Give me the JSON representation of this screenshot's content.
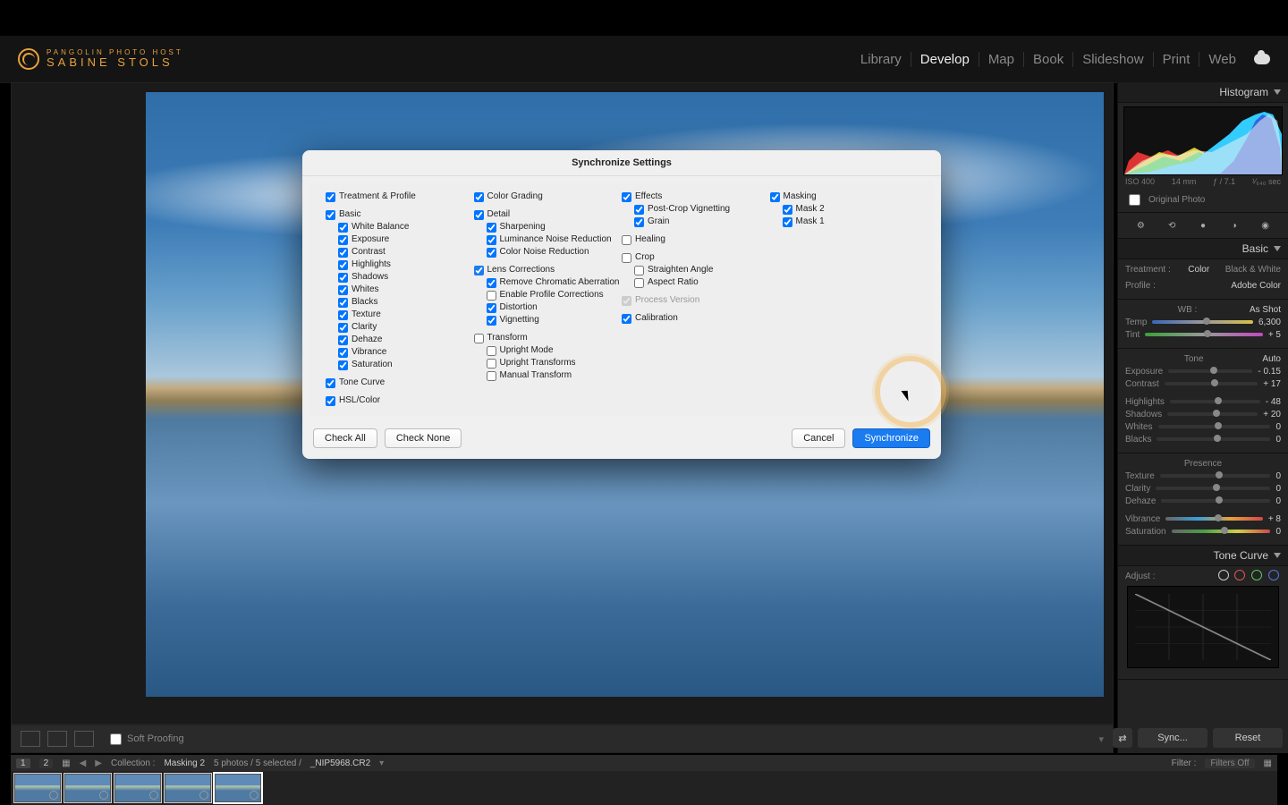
{
  "logo": {
    "line1": "PANGOLIN PHOTO HOST",
    "line2": "SABINE STOLS"
  },
  "modules": [
    "Library",
    "Develop",
    "Map",
    "Book",
    "Slideshow",
    "Print",
    "Web"
  ],
  "active_module": "Develop",
  "stage": {
    "soft_proof": "Soft Proofing"
  },
  "filmstrip": {
    "layout": "1",
    "layout2": "2",
    "collection_label": "Collection :",
    "collection_name": "Masking 2",
    "selection": "5 photos / 5 selected /",
    "filename": "_NIP5968.CR2",
    "filter_label": "Filter :",
    "filter_value": "Filters Off"
  },
  "side": {
    "histogram_title": "Histogram",
    "hist_meta": {
      "iso": "ISO 400",
      "fl": "14 mm",
      "ap": "ƒ / 7.1",
      "ss": "¹⁄₆₄₀ sec"
    },
    "original": "Original Photo",
    "basic_title": "Basic",
    "treatment_label": "Treatment :",
    "treatment_color": "Color",
    "treatment_bw": "Black & White",
    "profile_label": "Profile :",
    "profile_value": "Adobe Color",
    "wb_label": "WB :",
    "wb_value": "As Shot",
    "temp_label": "Temp",
    "temp_value": "6,300",
    "tint_label": "Tint",
    "tint_value": "+ 5",
    "tone_label": "Tone",
    "auto": "Auto",
    "exposure_label": "Exposure",
    "exposure_value": "- 0.15",
    "contrast_label": "Contrast",
    "contrast_value": "+ 17",
    "highlights_label": "Highlights",
    "highlights_value": "- 48",
    "shadows_label": "Shadows",
    "shadows_value": "+ 20",
    "whites_label": "Whites",
    "whites_value": "0",
    "blacks_label": "Blacks",
    "blacks_value": "0",
    "presence_label": "Presence",
    "texture_label": "Texture",
    "texture_value": "0",
    "clarity_label": "Clarity",
    "clarity_value": "0",
    "dehaze_label": "Dehaze",
    "dehaze_value": "0",
    "vibrance_label": "Vibrance",
    "vibrance_value": "+ 8",
    "saturation_label": "Saturation",
    "saturation_value": "0",
    "tonecurve_title": "Tone Curve",
    "adjust_label": "Adjust :",
    "sync_btn": "Sync...",
    "reset_btn": "Reset"
  },
  "dialog": {
    "title": "Synchronize Settings",
    "col1": {
      "treatment": "Treatment & Profile",
      "basic": "Basic",
      "basic_items": [
        "White Balance",
        "Exposure",
        "Contrast",
        "Highlights",
        "Shadows",
        "Whites",
        "Blacks",
        "Texture",
        "Clarity",
        "Dehaze",
        "Vibrance",
        "Saturation"
      ],
      "tone": "Tone Curve",
      "hsl": "HSL/Color"
    },
    "col2": {
      "color": "Color Grading",
      "detail": "Detail",
      "detail_items": [
        "Sharpening",
        "Luminance Noise Reduction",
        "Color Noise Reduction"
      ],
      "lens": "Lens Corrections",
      "lens_items": {
        "rca": "Remove Chromatic Aberration",
        "epc": "Enable Profile Corrections",
        "dist": "Distortion",
        "vig": "Vignetting"
      },
      "transform": "Transform",
      "transform_items": [
        "Upright Mode",
        "Upright Transforms",
        "Manual Transform"
      ]
    },
    "col3": {
      "effects": "Effects",
      "effects_items": [
        "Post-Crop Vignetting",
        "Grain"
      ],
      "healing": "Healing",
      "crop": "Crop",
      "crop_items": [
        "Straighten Angle",
        "Aspect Ratio"
      ],
      "process": "Process Version",
      "calibration": "Calibration"
    },
    "col4": {
      "masking": "Masking",
      "mask_items": [
        "Mask 2",
        "Mask 1"
      ]
    },
    "check_all": "Check All",
    "check_none": "Check None",
    "cancel": "Cancel",
    "synchronize": "Synchronize"
  }
}
